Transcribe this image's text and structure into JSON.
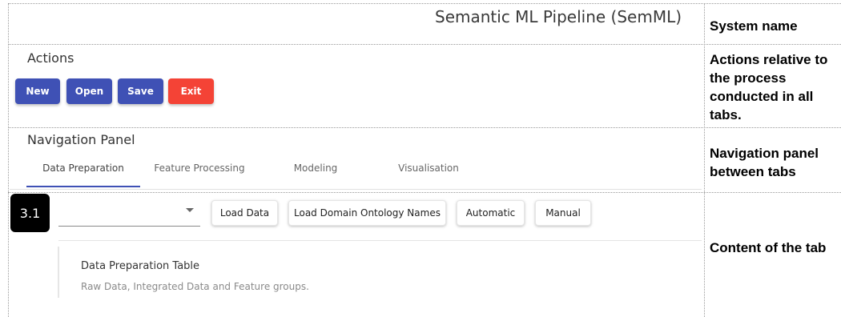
{
  "header": {
    "app_title": "Semantic ML Pipeline (SemML)"
  },
  "actions": {
    "title": "Actions",
    "buttons": [
      {
        "label": "New",
        "color": "#3f51b5"
      },
      {
        "label": "Open",
        "color": "#3f51b5"
      },
      {
        "label": "Save",
        "color": "#3f51b5"
      },
      {
        "label": "Exit",
        "color": "#f44336"
      }
    ]
  },
  "navigation": {
    "title": "Navigation Panel",
    "active_color": "#3f51b5",
    "tabs": [
      {
        "label": "Data Preparation",
        "active": true
      },
      {
        "label": "Feature Processing",
        "active": false
      },
      {
        "label": "Modeling",
        "active": false
      },
      {
        "label": "Visualisation",
        "active": false
      }
    ]
  },
  "content": {
    "step_badge": "3.1",
    "select": {
      "value": ""
    },
    "buttons": [
      {
        "label": "Load Data"
      },
      {
        "label": "Load Domain Ontology Names"
      },
      {
        "label": "Automatic"
      },
      {
        "label": "Manual"
      }
    ],
    "table": {
      "title": "Data Preparation Table",
      "subtitle": "Raw Data, Integrated Data and Feature groups."
    }
  },
  "annotations": {
    "system_name": "System name",
    "actions": "Actions relative to the process conducted in all tabs.",
    "navigation": "Navigation panel between tabs",
    "content": "Content of the tab"
  }
}
